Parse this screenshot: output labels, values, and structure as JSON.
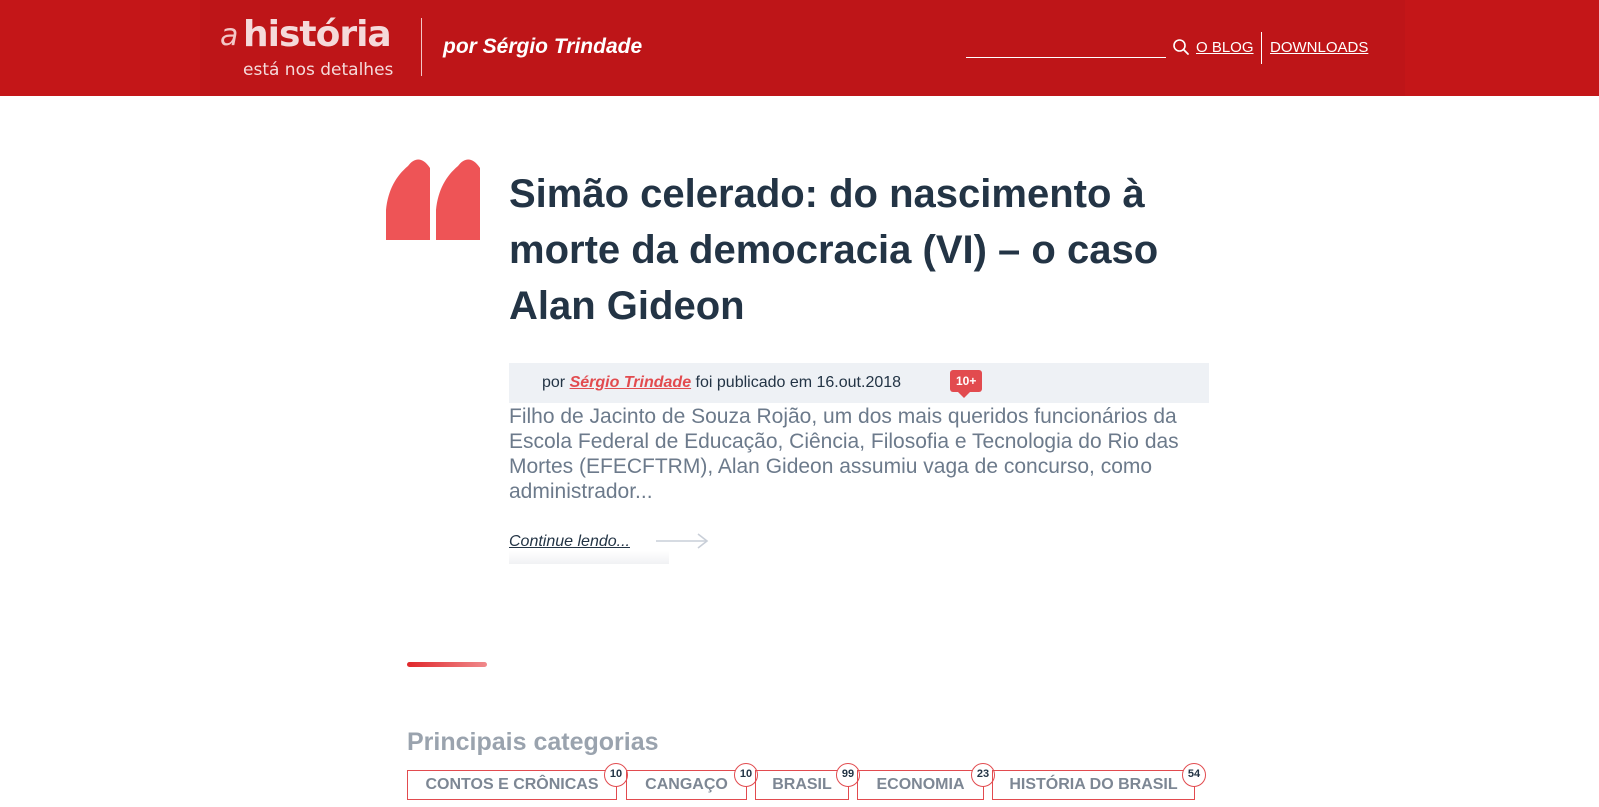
{
  "header": {
    "logo_prefix": "a",
    "logo_title": "história",
    "logo_subtitle": "está nos detalhes",
    "byline": "por Sérgio Trindade",
    "search_placeholder": "",
    "nav": [
      {
        "label": "O BLOG"
      },
      {
        "label": "DOWNLOADS"
      }
    ]
  },
  "post": {
    "title": "Simão celerado: do nascimento à morte da democracia (VI) – o caso Alan Gideon",
    "meta_prefix": "por",
    "author": "Sérgio Trindade",
    "published_text": "foi publicado em 16.out.2018",
    "comments_badge": "10+",
    "excerpt": "Filho de Jacinto de Souza Rojão, um dos mais queridos funcionários da Escola Federal de Educação, Ciência, Filosofia e Tecnologia do Rio das Mortes (EFECFTRM), Alan Gideon assumiu vaga de concurso, como administrador...",
    "continue_label": "Continue lendo..."
  },
  "categories": {
    "heading": "Principais categorias",
    "items": [
      {
        "label": "CONTOS E CRÔNICAS",
        "count": "10"
      },
      {
        "label": "CANGAÇO",
        "count": "10"
      },
      {
        "label": "BRASIL",
        "count": "99"
      },
      {
        "label": "ECONOMIA",
        "count": "23"
      },
      {
        "label": "HISTÓRIA DO BRASIL",
        "count": "54"
      }
    ]
  },
  "colors": {
    "header_bg": "#c41618",
    "accent": "#e24b4f",
    "title_text": "#233445",
    "excerpt_text": "#6c7a8b",
    "meta_bg": "#eef1f5"
  },
  "icons": {
    "search": "search-icon",
    "quote": "quote-mark-icon",
    "arrow": "arrow-right-icon"
  }
}
